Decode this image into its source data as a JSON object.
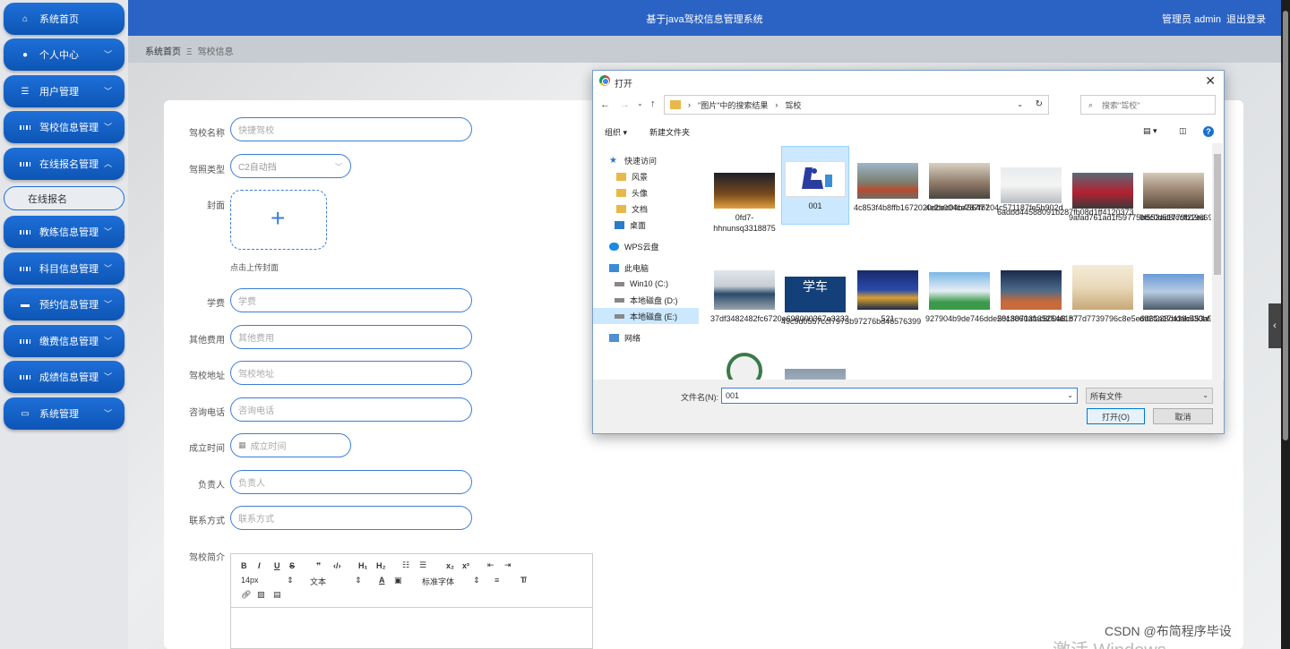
{
  "sidebar": {
    "items": [
      {
        "label": "系统首页",
        "icon": "home-icon"
      },
      {
        "label": "个人中心",
        "icon": "user-icon"
      },
      {
        "label": "用户管理",
        "icon": "list-icon"
      },
      {
        "label": "驾校信息管理",
        "icon": "grid-icon"
      },
      {
        "label": "在线报名管理",
        "icon": "grid-icon"
      },
      {
        "label": "教练信息管理",
        "icon": "grid-icon"
      },
      {
        "label": "科目信息管理",
        "icon": "grid-icon"
      },
      {
        "label": "预约信息管理",
        "icon": "chat-icon"
      },
      {
        "label": "缴费信息管理",
        "icon": "grid-icon"
      },
      {
        "label": "成绩信息管理",
        "icon": "grid-icon"
      },
      {
        "label": "系统管理",
        "icon": "monitor-icon"
      }
    ],
    "sub_item": "在线报名"
  },
  "header": {
    "title": "基于java驾校信息管理系统",
    "user": "管理员 admin",
    "logout": "退出登录"
  },
  "breadcrumb": {
    "home": "系统首页",
    "current": "驾校信息"
  },
  "form": {
    "name": {
      "label": "驾校名称",
      "placeholder": "快捷驾校"
    },
    "license": {
      "label": "驾照类型",
      "value": "C2自动挡"
    },
    "cover": {
      "label": "封面",
      "hint": "点击上传封面"
    },
    "fee": {
      "label": "学费",
      "placeholder": "学费"
    },
    "other_fee": {
      "label": "其他费用",
      "placeholder": "其他费用"
    },
    "address": {
      "label": "驾校地址",
      "placeholder": "驾校地址"
    },
    "phone": {
      "label": "咨询电话",
      "placeholder": "咨询电话"
    },
    "founded": {
      "label": "成立时间",
      "placeholder": "成立时间"
    },
    "manager": {
      "label": "负责人",
      "placeholder": "负责人"
    },
    "contact": {
      "label": "联系方式",
      "placeholder": "联系方式"
    },
    "intro": {
      "label": "驾校简介"
    }
  },
  "editor": {
    "font_size": "14px",
    "text_type": "文本",
    "font_family": "标准字体"
  },
  "dialog": {
    "title": "打开",
    "path": [
      "\"图片\"中的搜索结果",
      "驾校"
    ],
    "search_placeholder": "搜索\"驾校\"",
    "organize": "组织 ▾",
    "new_folder": "新建文件夹",
    "tree": [
      "快速访问",
      "风景",
      "头像",
      "文档",
      "桌面",
      "WPS云盘",
      "此电脑",
      "Win10 (C:)",
      "本地磁盘 (D:)",
      "本地磁盘 (E:)",
      "网络"
    ],
    "files": [
      "0fd7-hhnunsq3318875",
      "001",
      "4c853f4b8ffb1672020dbec04b456477",
      "4e2b004ce787fb204c571187fe5b902d",
      "6adbd44588091b287fb08d1ff4120373",
      "9afad761ad1f59775bdc0d51779f22ed",
      "9f553ad8fccfb19669e266d87300a7f2",
      "37df3482482fc6720e698000367e3232",
      "49c9d0557ccf7973b97276bd46576399",
      "521",
      "927904b9de746dde58c3860afac800a8",
      "201807131352546187",
      "b77d7739796c8e5e6d61a17bdab530bf",
      "d92f238c439c453a9edb2f05a44db232"
    ],
    "filename_label": "文件名(N):",
    "filename_value": "001",
    "filetype": "所有文件",
    "open": "打开(O)",
    "cancel": "取消",
    "thumb_text": "学车"
  },
  "watermark": "CSDN @布简程序毕设",
  "activate": "激活 Windows"
}
